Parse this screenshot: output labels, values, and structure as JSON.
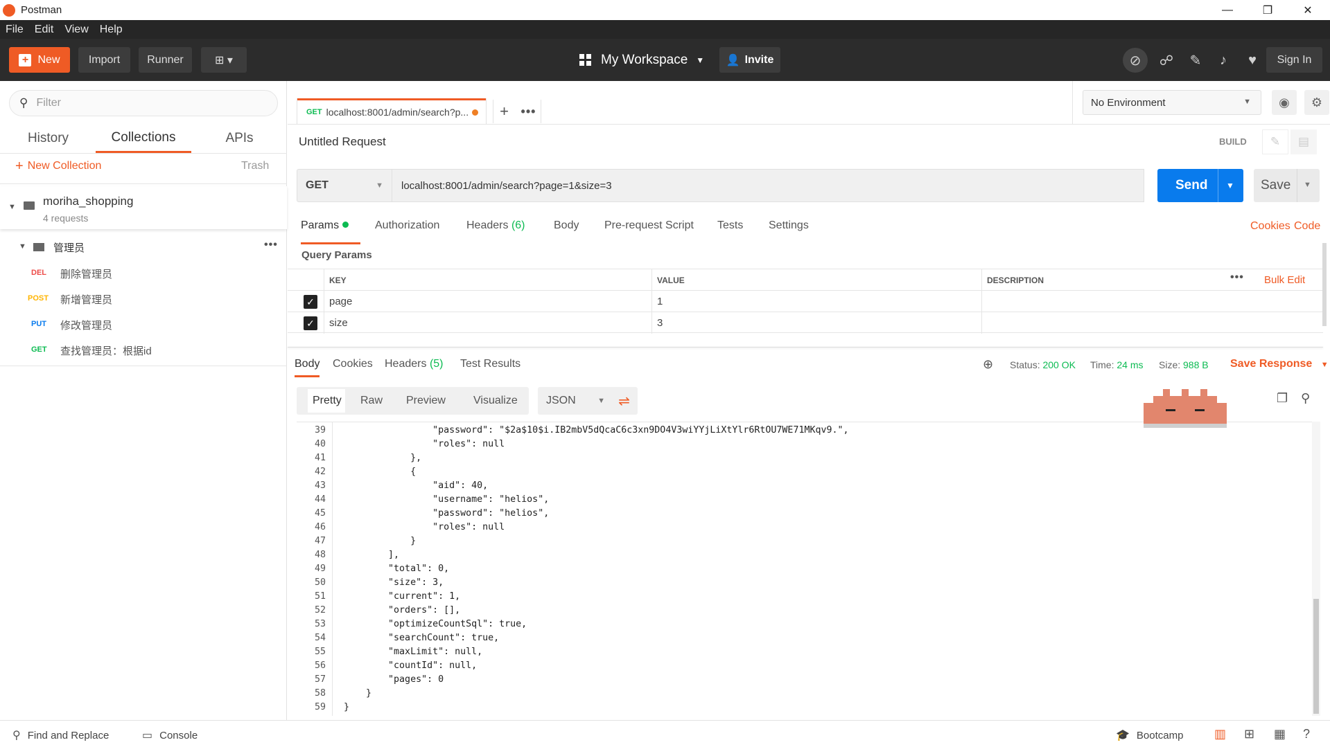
{
  "window": {
    "title": "Postman",
    "minimize": "—",
    "restore": "❐",
    "close": "✕"
  },
  "menu": [
    "File",
    "Edit",
    "View",
    "Help"
  ],
  "header": {
    "new_label": "New",
    "import_label": "Import",
    "runner_label": "Runner",
    "workspace_label": "My Workspace",
    "invite_label": "Invite",
    "signin_label": "Sign In"
  },
  "sidebar": {
    "filter_placeholder": "Filter",
    "tabs": [
      "History",
      "Collections",
      "APIs"
    ],
    "active_tab": "Collections",
    "new_collection": "New Collection",
    "trash": "Trash",
    "collection": {
      "name": "moriha_shopping",
      "count": "4 requests"
    },
    "folder": {
      "name": "管理员"
    },
    "requests": [
      {
        "method": "DEL",
        "name": "删除管理员",
        "color": "#ed4b48"
      },
      {
        "method": "POST",
        "name": "新增管理员",
        "color": "#ffb400"
      },
      {
        "method": "PUT",
        "name": "修改管理员",
        "color": "#097bed"
      },
      {
        "method": "GET",
        "name": "查找管理员：根据id",
        "color": "#0cbb52"
      }
    ]
  },
  "tab": {
    "method": "GET",
    "title": "localhost:8001/admin/search?p..."
  },
  "environment": {
    "selected": "No Environment"
  },
  "request": {
    "name": "Untitled Request",
    "build_label": "BUILD",
    "method": "GET",
    "url": "localhost:8001/admin/search?page=1&size=3",
    "send_label": "Send",
    "save_label": "Save",
    "tabs": [
      "Params",
      "Authorization",
      "Headers",
      "Body",
      "Pre-request Script",
      "Tests",
      "Settings"
    ],
    "headers_count": "(6)",
    "cookies_label": "Cookies",
    "code_label": "Code"
  },
  "params": {
    "title": "Query Params",
    "columns": [
      "KEY",
      "VALUE",
      "DESCRIPTION"
    ],
    "bulk_edit": "Bulk Edit",
    "rows": [
      {
        "key": "page",
        "value": "1"
      },
      {
        "key": "size",
        "value": "3"
      }
    ]
  },
  "response": {
    "tabs": [
      "Body",
      "Cookies",
      "Headers",
      "Test Results"
    ],
    "headers_count": "(5)",
    "status_label": "Status:",
    "status": "200 OK",
    "time_label": "Time:",
    "time": "24 ms",
    "size_label": "Size:",
    "size": "988 B",
    "save_response": "Save Response",
    "views": [
      "Pretty",
      "Raw",
      "Preview",
      "Visualize"
    ],
    "format": "JSON",
    "lines": [
      {
        "n": "39",
        "t": "                \"password\": \"$2a$10$i.IB2mbV5dQcaC6c3xn9DO4V3wiYYjLiXtYlr6RtOU7WE71MKqv9.\","
      },
      {
        "n": "40",
        "t": "                \"roles\": null"
      },
      {
        "n": "41",
        "t": "            },"
      },
      {
        "n": "42",
        "t": "            {"
      },
      {
        "n": "43",
        "t": "                \"aid\": 40,"
      },
      {
        "n": "44",
        "t": "                \"username\": \"helios\","
      },
      {
        "n": "45",
        "t": "                \"password\": \"helios\","
      },
      {
        "n": "46",
        "t": "                \"roles\": null"
      },
      {
        "n": "47",
        "t": "            }"
      },
      {
        "n": "48",
        "t": "        ],"
      },
      {
        "n": "49",
        "t": "        \"total\": 0,"
      },
      {
        "n": "50",
        "t": "        \"size\": 3,"
      },
      {
        "n": "51",
        "t": "        \"current\": 1,"
      },
      {
        "n": "52",
        "t": "        \"orders\": [],"
      },
      {
        "n": "53",
        "t": "        \"optimizeCountSql\": true,"
      },
      {
        "n": "54",
        "t": "        \"searchCount\": true,"
      },
      {
        "n": "55",
        "t": "        \"maxLimit\": null,"
      },
      {
        "n": "56",
        "t": "        \"countId\": null,"
      },
      {
        "n": "57",
        "t": "        \"pages\": 0"
      },
      {
        "n": "58",
        "t": "    }"
      },
      {
        "n": "59",
        "t": "}"
      }
    ]
  },
  "statusbar": {
    "find_replace": "Find and Replace",
    "console": "Console",
    "bootcamp": "Bootcamp"
  },
  "colors": {
    "accent": "#ef5b25",
    "send": "#097bed",
    "ok": "#0cbb52"
  }
}
